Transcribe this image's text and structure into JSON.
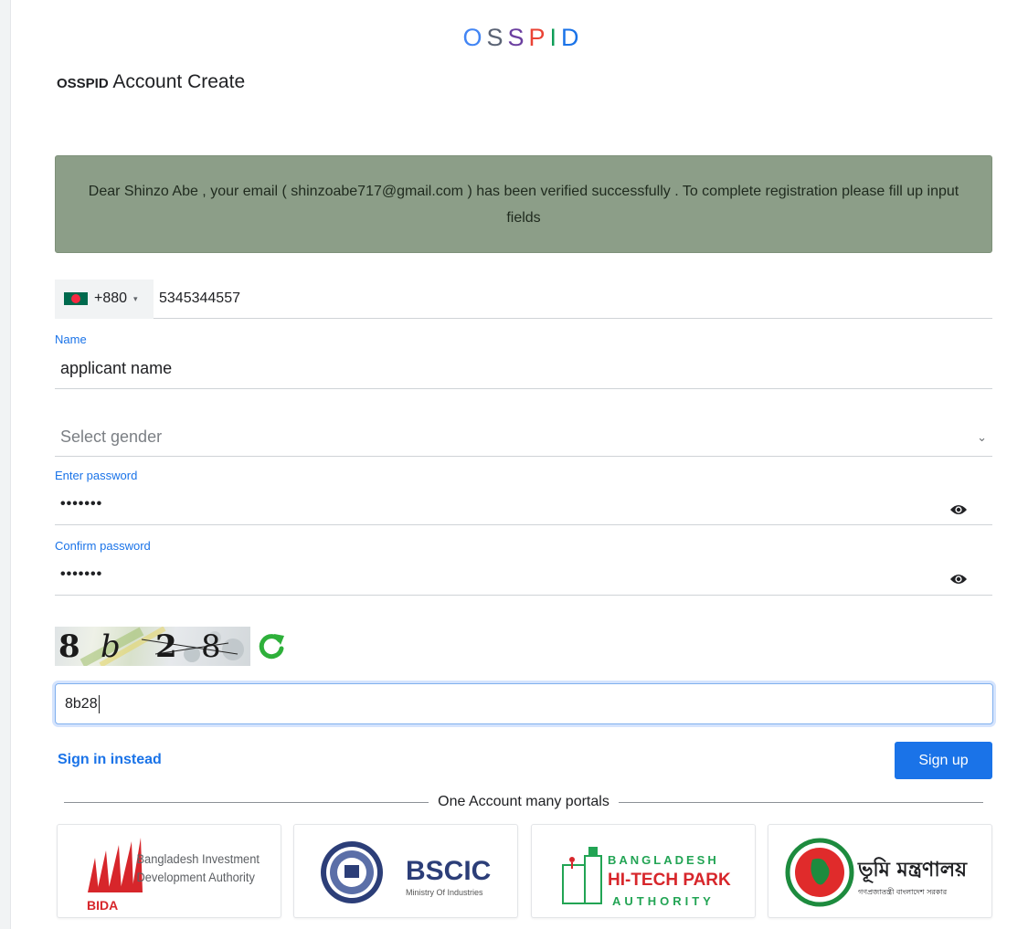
{
  "brand": {
    "letters": [
      "O",
      "S",
      "S",
      "P",
      "I",
      "D"
    ],
    "colors": [
      "#4285f4",
      "#5a6374",
      "#6b3fa0",
      "#ea4335",
      "#0f9d58",
      "#1a73e8"
    ]
  },
  "heading": {
    "strong": "OSSPID",
    "text": "Account Create"
  },
  "alert": {
    "message": "Dear Shinzo Abe , your email ( shinzoabe717@gmail.com ) has been verified successfully . To complete registration please fill up input fields",
    "bg_color": "#8c9e88"
  },
  "phone": {
    "dial_code": "+880",
    "caret": "▾",
    "value": "5345344557",
    "flag_icon": "bangladesh-flag-icon"
  },
  "name_field": {
    "label": "Name",
    "value": "applicant name"
  },
  "gender": {
    "placeholder": "Select gender",
    "chevron": "⌄"
  },
  "password": {
    "label": "Enter password",
    "value": "•••••••",
    "toggle_icon": "eye-icon"
  },
  "confirm_password": {
    "label": "Confirm password",
    "value": "•••••••",
    "toggle_icon": "eye-icon"
  },
  "captcha": {
    "image_text": [
      "8",
      "b",
      "2",
      "8"
    ],
    "refresh_icon": "refresh-icon",
    "input_value": "8b28"
  },
  "actions": {
    "signin": "Sign in instead",
    "signup": "Sign up",
    "accent": "#1a73e8"
  },
  "portals": {
    "divider_text": "One Account many portals",
    "bida": {
      "line1": "Bangladesh Investment",
      "line2": "Development Authority",
      "acronym": "BIDA"
    },
    "bscic": {
      "name": "BSCIC",
      "sub": "Ministry Of Industries"
    },
    "htpa": {
      "line1": "BANGLADESH",
      "line2": "HI-TECH PARK",
      "line3": "AUTHORITY"
    },
    "bhumi": {
      "title": "ভূমি মন্ত্রণালয়",
      "sub": "গণপ্রজাতন্ত্রী বাংলাদেশ সরকার"
    }
  }
}
